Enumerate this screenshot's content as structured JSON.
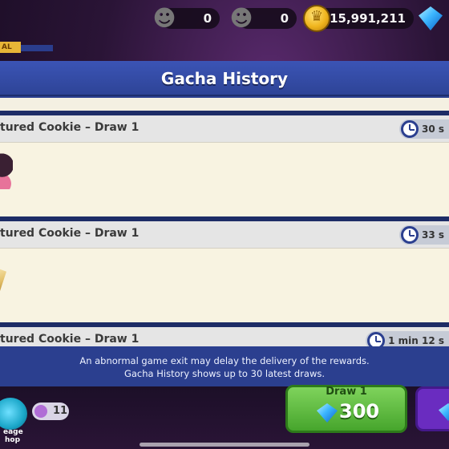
{
  "currency": {
    "ghost_a_value": "0",
    "ghost_b_value": "0",
    "coins_value": "15,991,211"
  },
  "background": {
    "tag_text": "AL",
    "lineage_label_1": "eage",
    "lineage_label_2": "hop",
    "token_count": "11",
    "draw_button_label": "Draw 1",
    "draw_button_cost": "300"
  },
  "modal": {
    "title": "Gacha History",
    "entries": [
      {
        "title": "tured Cookie – Draw 1",
        "time": "30 s"
      },
      {
        "title": "tured Cookie – Draw 1",
        "time": "33 s"
      },
      {
        "title": "tured Cookie – Draw 1",
        "time": "1 min 12 s"
      }
    ],
    "notice_line_1": "An abnormal game exit may delay the delivery of the rewards.",
    "notice_line_2": "Gacha History shows up to 30 latest draws."
  }
}
